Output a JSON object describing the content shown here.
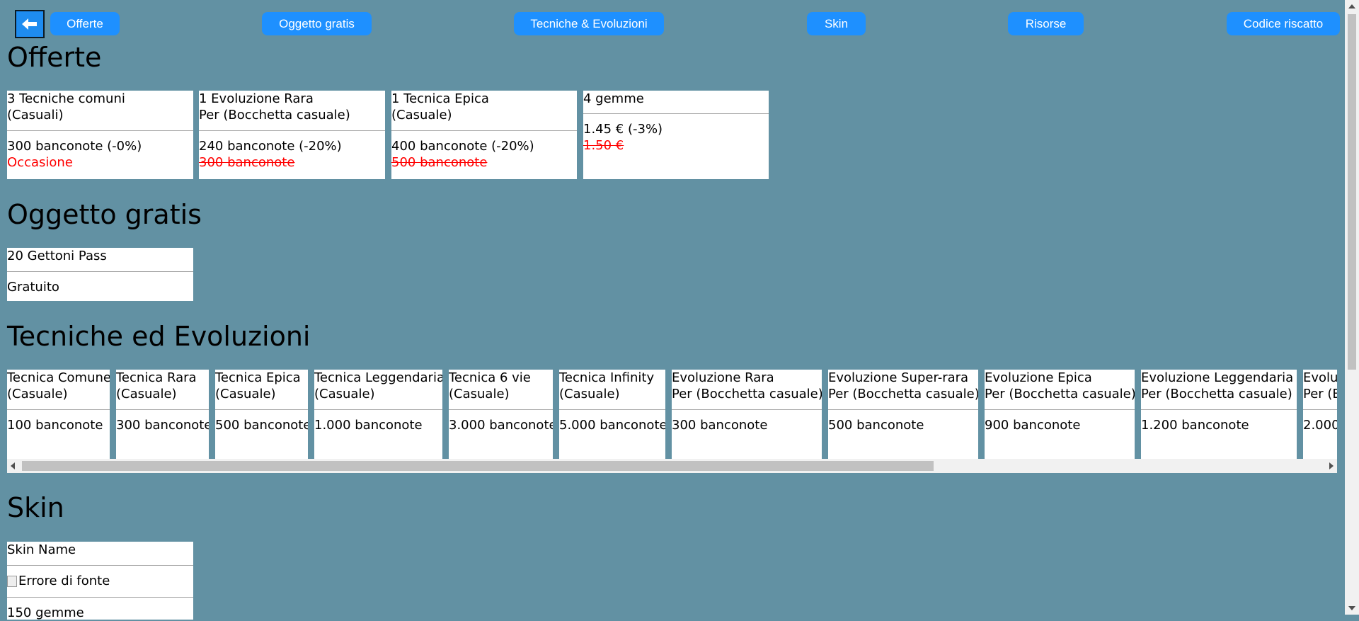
{
  "nav": {
    "back_icon": "left-arrow-icon",
    "items": [
      "Offerte",
      "Oggetto gratis",
      "Tecniche & Evoluzioni",
      "Skin",
      "Risorse",
      "Codice riscatto"
    ]
  },
  "offers": {
    "title": "Offerte",
    "cards": [
      {
        "line1": "3 Tecniche comuni",
        "line2": "(Casuali)",
        "price": "300 banconote (-0%)",
        "note": "Occasione"
      },
      {
        "line1": "1 Evoluzione Rara",
        "line2": "Per (Bocchetta casuale)",
        "price": "240 banconote (-20%)",
        "old_price": "300 banconote"
      },
      {
        "line1": "1 Tecnica Epica",
        "line2": "(Casuale)",
        "price": "400 banconote (-20%)",
        "old_price": "500 banconote"
      },
      {
        "line1": "4 gemme",
        "price": "1.45 € (-3%)",
        "old_price": "1.50 €"
      }
    ]
  },
  "free_item": {
    "title": "Oggetto gratis",
    "card": {
      "name": "20 Gettoni Pass",
      "price": "Gratuito"
    }
  },
  "techniques": {
    "title": "Tecniche ed Evoluzioni",
    "cards": [
      {
        "line1": "Tecnica Comune",
        "line2": "(Casuale)",
        "price": "100 banconote"
      },
      {
        "line1": "Tecnica Rara",
        "line2": "(Casuale)",
        "price": "300 banconote"
      },
      {
        "line1": "Tecnica Epica",
        "line2": "(Casuale)",
        "price": "500 banconote"
      },
      {
        "line1": "Tecnica Leggendaria",
        "line2": "(Casuale)",
        "price": "1.000 banconote"
      },
      {
        "line1": "Tecnica 6 vie",
        "line2": "(Casuale)",
        "price": "3.000 banconote"
      },
      {
        "line1": "Tecnica Infinity",
        "line2": "(Casuale)",
        "price": "5.000 banconote"
      },
      {
        "line1": "Evoluzione Rara",
        "line2": "Per (Bocchetta casuale)",
        "price": "300 banconote"
      },
      {
        "line1": "Evoluzione Super-rara",
        "line2": "Per (Bocchetta casuale)",
        "price": "500 banconote"
      },
      {
        "line1": "Evoluzione Epica",
        "line2": "Per (Bocchetta casuale)",
        "price": "900 banconote"
      },
      {
        "line1": "Evoluzione Leggendaria",
        "line2": "Per (Bocchetta casuale)",
        "price": "1.200 banconote"
      },
      {
        "line1": "Evolu",
        "line2": "Per (B",
        "price": "2.000"
      }
    ]
  },
  "skin": {
    "title": "Skin",
    "card": {
      "name": "Skin Name",
      "image_alt": "Errore di fonte",
      "price": "150 gemme"
    }
  },
  "colors": {
    "background": "#6291a3",
    "button": "#1e90ff",
    "discount": "#ff0000"
  }
}
